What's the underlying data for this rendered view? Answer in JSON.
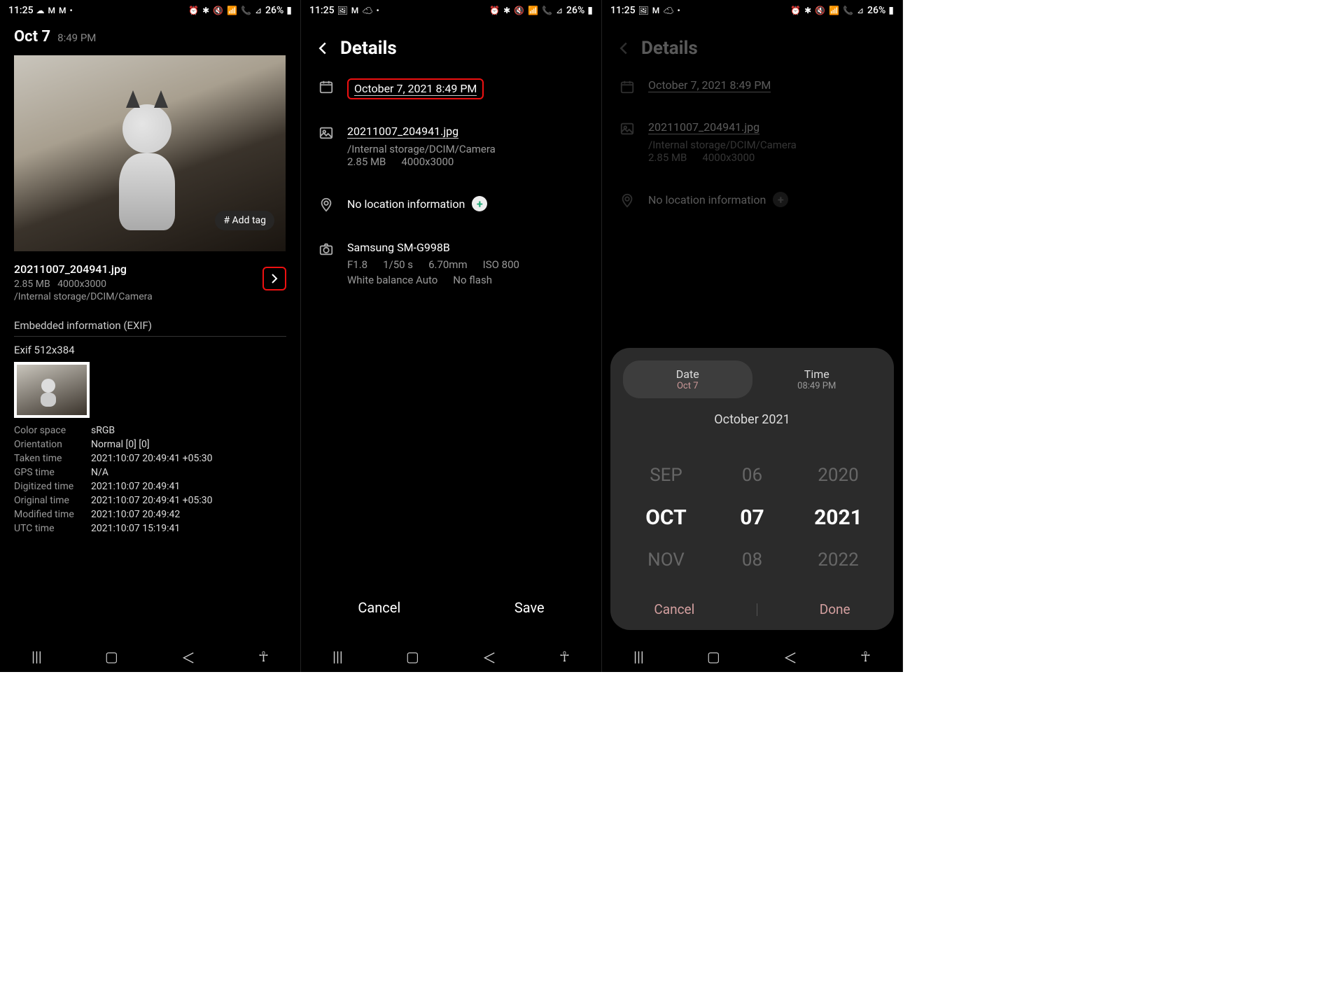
{
  "status": {
    "time": "11:25",
    "battery": "26%"
  },
  "p1": {
    "date": "Oct 7",
    "time": "8:49 PM",
    "add_tag": "# Add tag",
    "fname": "20211007_204941.jpg",
    "size": "2.85 MB",
    "dims": "4000x3000",
    "path": "/Internal storage/DCIM/Camera",
    "exif_header": "Embedded information (EXIF)",
    "exif_dim": "Exif 512x384",
    "exif": [
      {
        "k": "Color space",
        "v": "sRGB"
      },
      {
        "k": "Orientation",
        "v": "Normal [0] [0]"
      },
      {
        "k": "Taken time",
        "v": "2021:10:07 20:49:41 +05:30"
      },
      {
        "k": "GPS time",
        "v": "N/A"
      },
      {
        "k": "Digitized time",
        "v": "2021:10:07 20:49:41"
      },
      {
        "k": "Original time",
        "v": "2021:10:07 20:49:41 +05:30"
      },
      {
        "k": "Modified time",
        "v": "2021:10:07 20:49:42"
      },
      {
        "k": "UTC time",
        "v": "2021:10:07 15:19:41"
      }
    ]
  },
  "p2": {
    "title": "Details",
    "datetime": "October 7, 2021 8:49 PM",
    "fname": "20211007_204941.jpg",
    "path": "/Internal storage/DCIM/Camera",
    "size": "2.85 MB",
    "dims": "4000x3000",
    "loc": "No location information",
    "device": "Samsung SM-G998B",
    "cam": {
      "fstop": "F1.8",
      "shutter": "1/50 s",
      "focal": "6.70mm",
      "iso": "ISO 800",
      "wb": "White balance Auto",
      "flash": "No flash"
    },
    "cancel": "Cancel",
    "save": "Save"
  },
  "p3": {
    "title": "Details",
    "datetime": "October 7, 2021 8:49 PM",
    "fname": "20211007_204941.jpg",
    "path": "/Internal storage/DCIM/Camera",
    "size": "2.85 MB",
    "dims": "4000x3000",
    "loc": "No location information",
    "tab_date": "Date",
    "tab_date_sub": "Oct 7",
    "tab_time": "Time",
    "tab_time_sub": "08:49 PM",
    "month_hdr": "October 2021",
    "spin": {
      "m_prev": "SEP",
      "m_cur": "OCT",
      "m_next": "NOV",
      "d_prev": "06",
      "d_cur": "07",
      "d_next": "08",
      "y_prev": "2020",
      "y_cur": "2021",
      "y_next": "2022"
    },
    "cancel": "Cancel",
    "done": "Done"
  }
}
